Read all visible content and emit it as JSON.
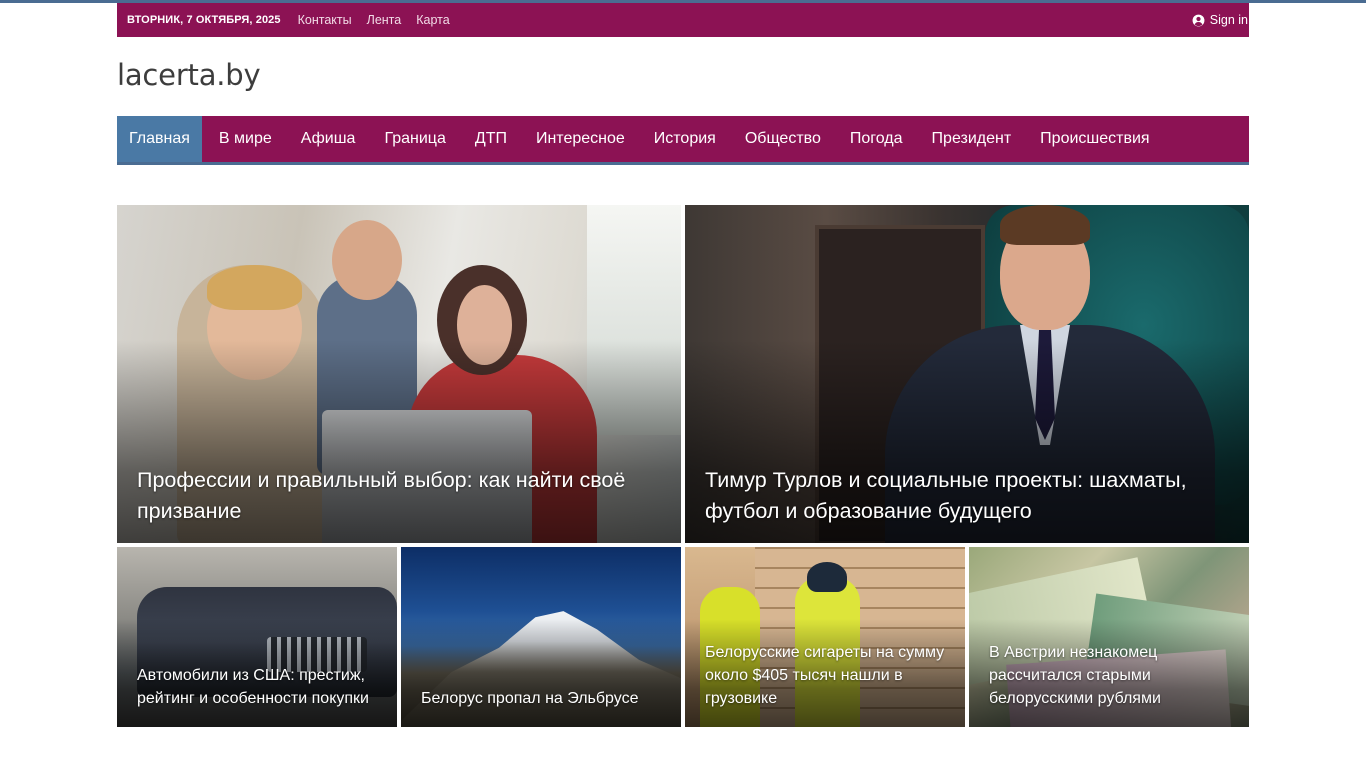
{
  "topbar": {
    "date": "ВТОРНИК, 7 ОКТЯБРЯ, 2025",
    "links": [
      "Контакты",
      "Лента",
      "Карта"
    ],
    "signin_label": "Sign in"
  },
  "logo": {
    "text": "lacerta.by"
  },
  "nav": {
    "items": [
      {
        "label": "Главная"
      },
      {
        "label": "В мире"
      },
      {
        "label": "Афиша"
      },
      {
        "label": "Граница"
      },
      {
        "label": "ДТП"
      },
      {
        "label": "Интересное"
      },
      {
        "label": "История"
      },
      {
        "label": "Общество"
      },
      {
        "label": "Погода"
      },
      {
        "label": "Президент"
      },
      {
        "label": "Происшествия"
      }
    ]
  },
  "featured": [
    {
      "title": "Профессии и правильный выбор: как найти своё призвание"
    },
    {
      "title": "Тимур Турлов и социальные проекты: шахматы, футбол и образование будущего"
    },
    {
      "title": "Автомобили из США: престиж, рейтинг и особенности покупки"
    },
    {
      "title": "Белорус пропал на Эльбрусе"
    },
    {
      "title": "Белорусские сигареты на сумму около $405 тысяч нашли в грузовике"
    },
    {
      "title": "В Австрии незнакомец рассчитался старыми белорусскими рублями"
    }
  ],
  "colors": {
    "brand": "#8c1254",
    "accent": "#4a79a5",
    "topline": "#4a6c92"
  },
  "icons": {
    "signin": "user-circle-icon"
  }
}
